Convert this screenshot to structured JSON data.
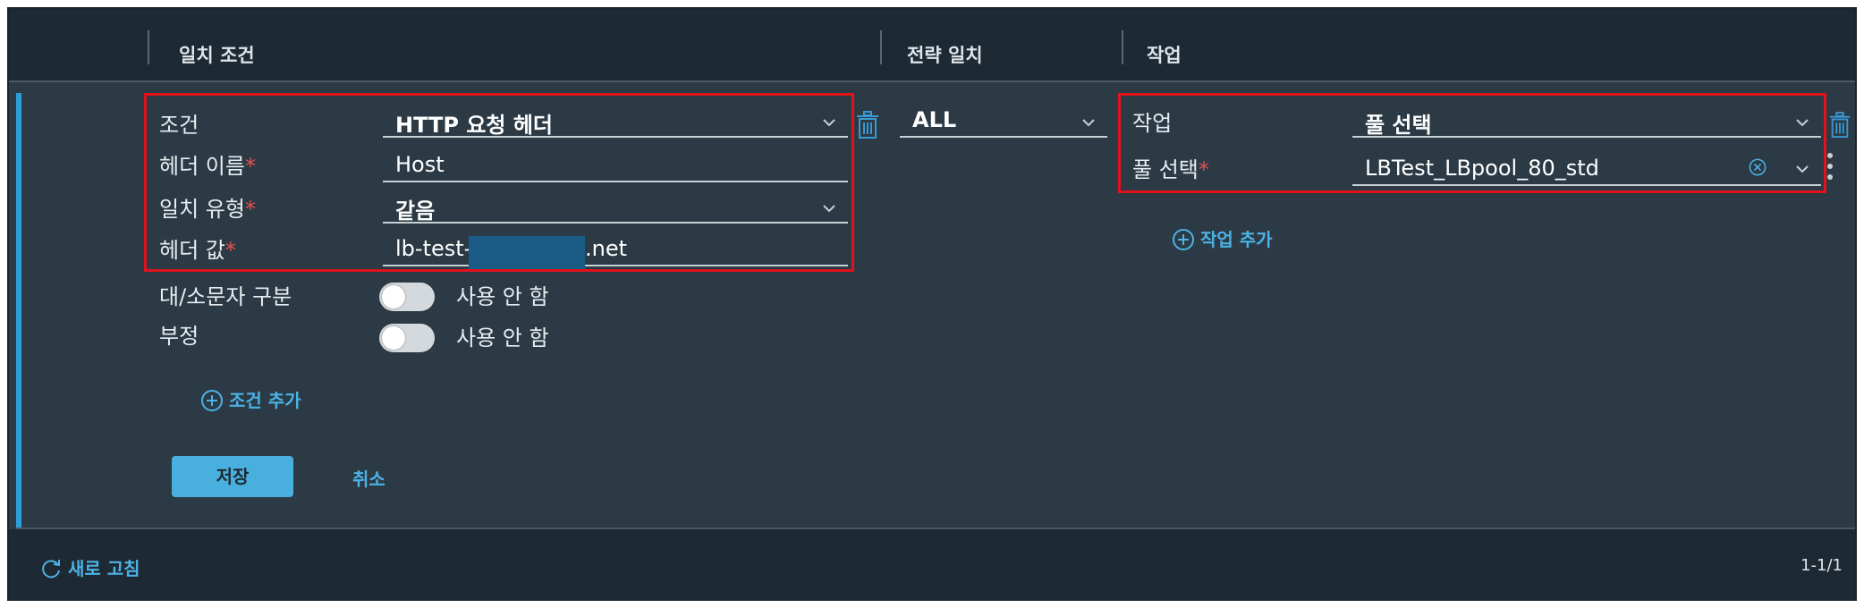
{
  "header": {
    "col_match": "일치 조건",
    "col_strategy": "전략 일치",
    "col_action": "작업"
  },
  "condition": {
    "condition_label": "조건",
    "condition_value": "HTTP 요청 헤더",
    "header_name_label": "헤더 이름",
    "header_name_value": "Host",
    "match_type_label": "일치 유형",
    "match_type_value": "같음",
    "header_value_label": "헤더 값",
    "header_value_prefix": "lb-test-2.",
    "header_value_suffix": ".net",
    "case_label": "대/소문자 구분",
    "case_state": "사용 안 함",
    "negate_label": "부정",
    "negate_state": "사용 안 함",
    "add_condition": "조건 추가",
    "required_mark": "*"
  },
  "strategy": {
    "value": "ALL"
  },
  "action": {
    "action_label": "작업",
    "action_value": "풀 선택",
    "pool_label": "풀 선택",
    "pool_value": "LBTest_LBpool_80_std",
    "add_action": "작업 추가"
  },
  "buttons": {
    "save": "저장",
    "cancel": "취소"
  },
  "footer": {
    "refresh": "새로 고침",
    "pager": "1-1/1"
  },
  "colors": {
    "accent": "#2d9fd8",
    "highlight_box": "#e0121c",
    "background": "#2b3a44",
    "header_bg": "#1e2a33"
  },
  "icons": [
    "trash-icon",
    "chevron-down-icon",
    "clear-circle-icon",
    "plus-circle-icon",
    "refresh-icon",
    "kebab-icon"
  ]
}
